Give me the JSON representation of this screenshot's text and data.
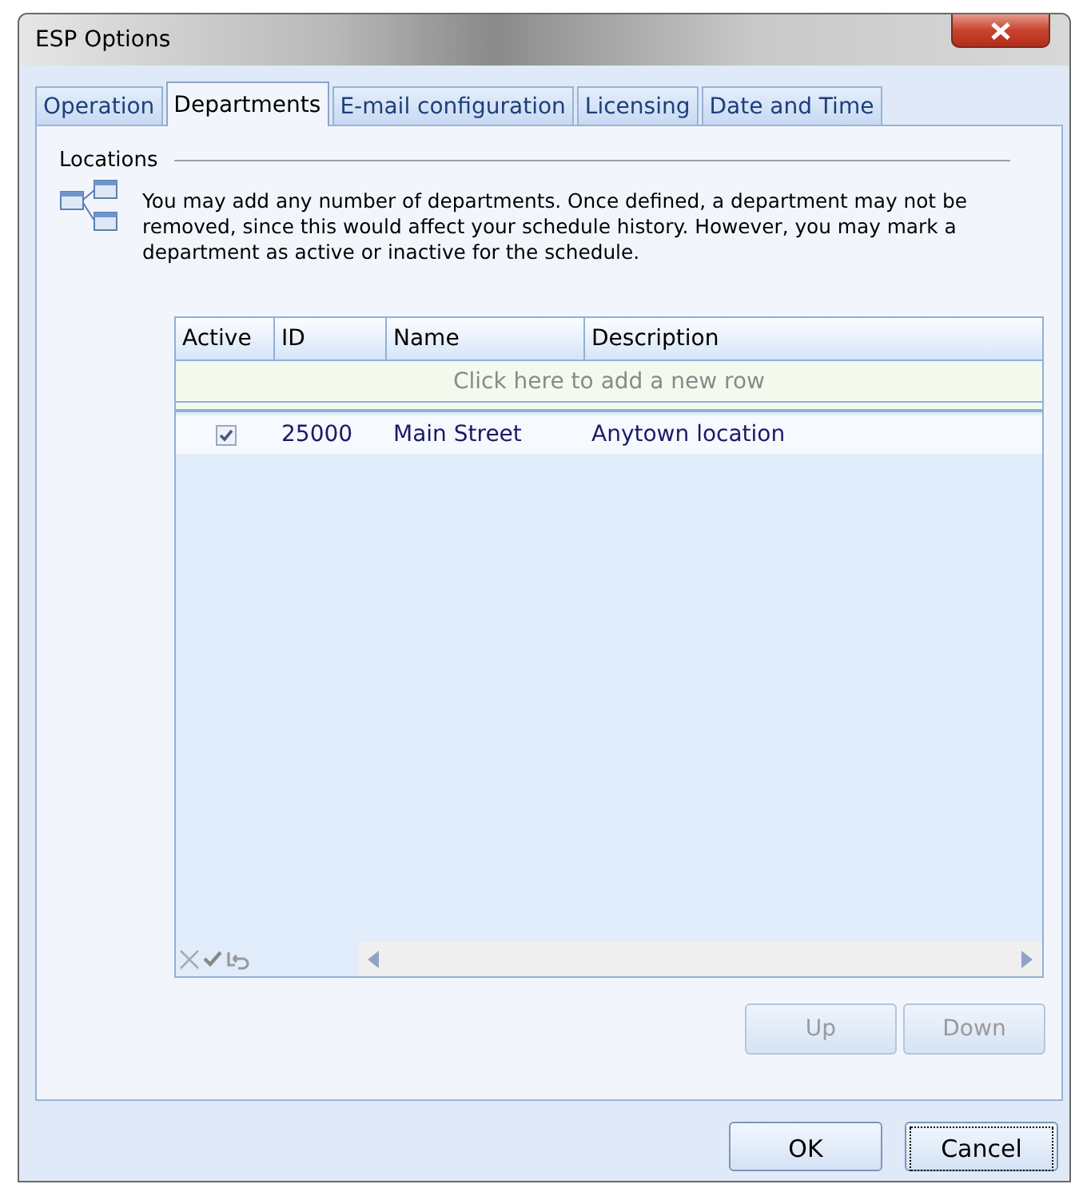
{
  "window": {
    "title": "ESP Options"
  },
  "tabs": [
    {
      "label": "Operation",
      "selected": false
    },
    {
      "label": "Departments",
      "selected": true
    },
    {
      "label": "E-mail configuration",
      "selected": false
    },
    {
      "label": "Licensing",
      "selected": false
    },
    {
      "label": "Date and Time",
      "selected": false
    }
  ],
  "group": {
    "label": "Locations",
    "description": "You may add any number of departments. Once defined, a department may not be removed, since this would affect your schedule history. However, you may mark a department as active or inactive for the schedule."
  },
  "grid": {
    "columns": [
      "Active",
      "ID",
      "Name",
      "Description"
    ],
    "new_row_prompt": "Click here to add a new row",
    "rows": [
      {
        "active": true,
        "id": "25000",
        "name": "Main Street",
        "description": "Anytown location"
      }
    ]
  },
  "move_buttons": [
    {
      "label": "Up",
      "disabled": true
    },
    {
      "label": "Down",
      "disabled": true
    }
  ],
  "dialog_buttons": [
    {
      "label": "OK",
      "focused": false
    },
    {
      "label": "Cancel",
      "focused": true
    }
  ]
}
